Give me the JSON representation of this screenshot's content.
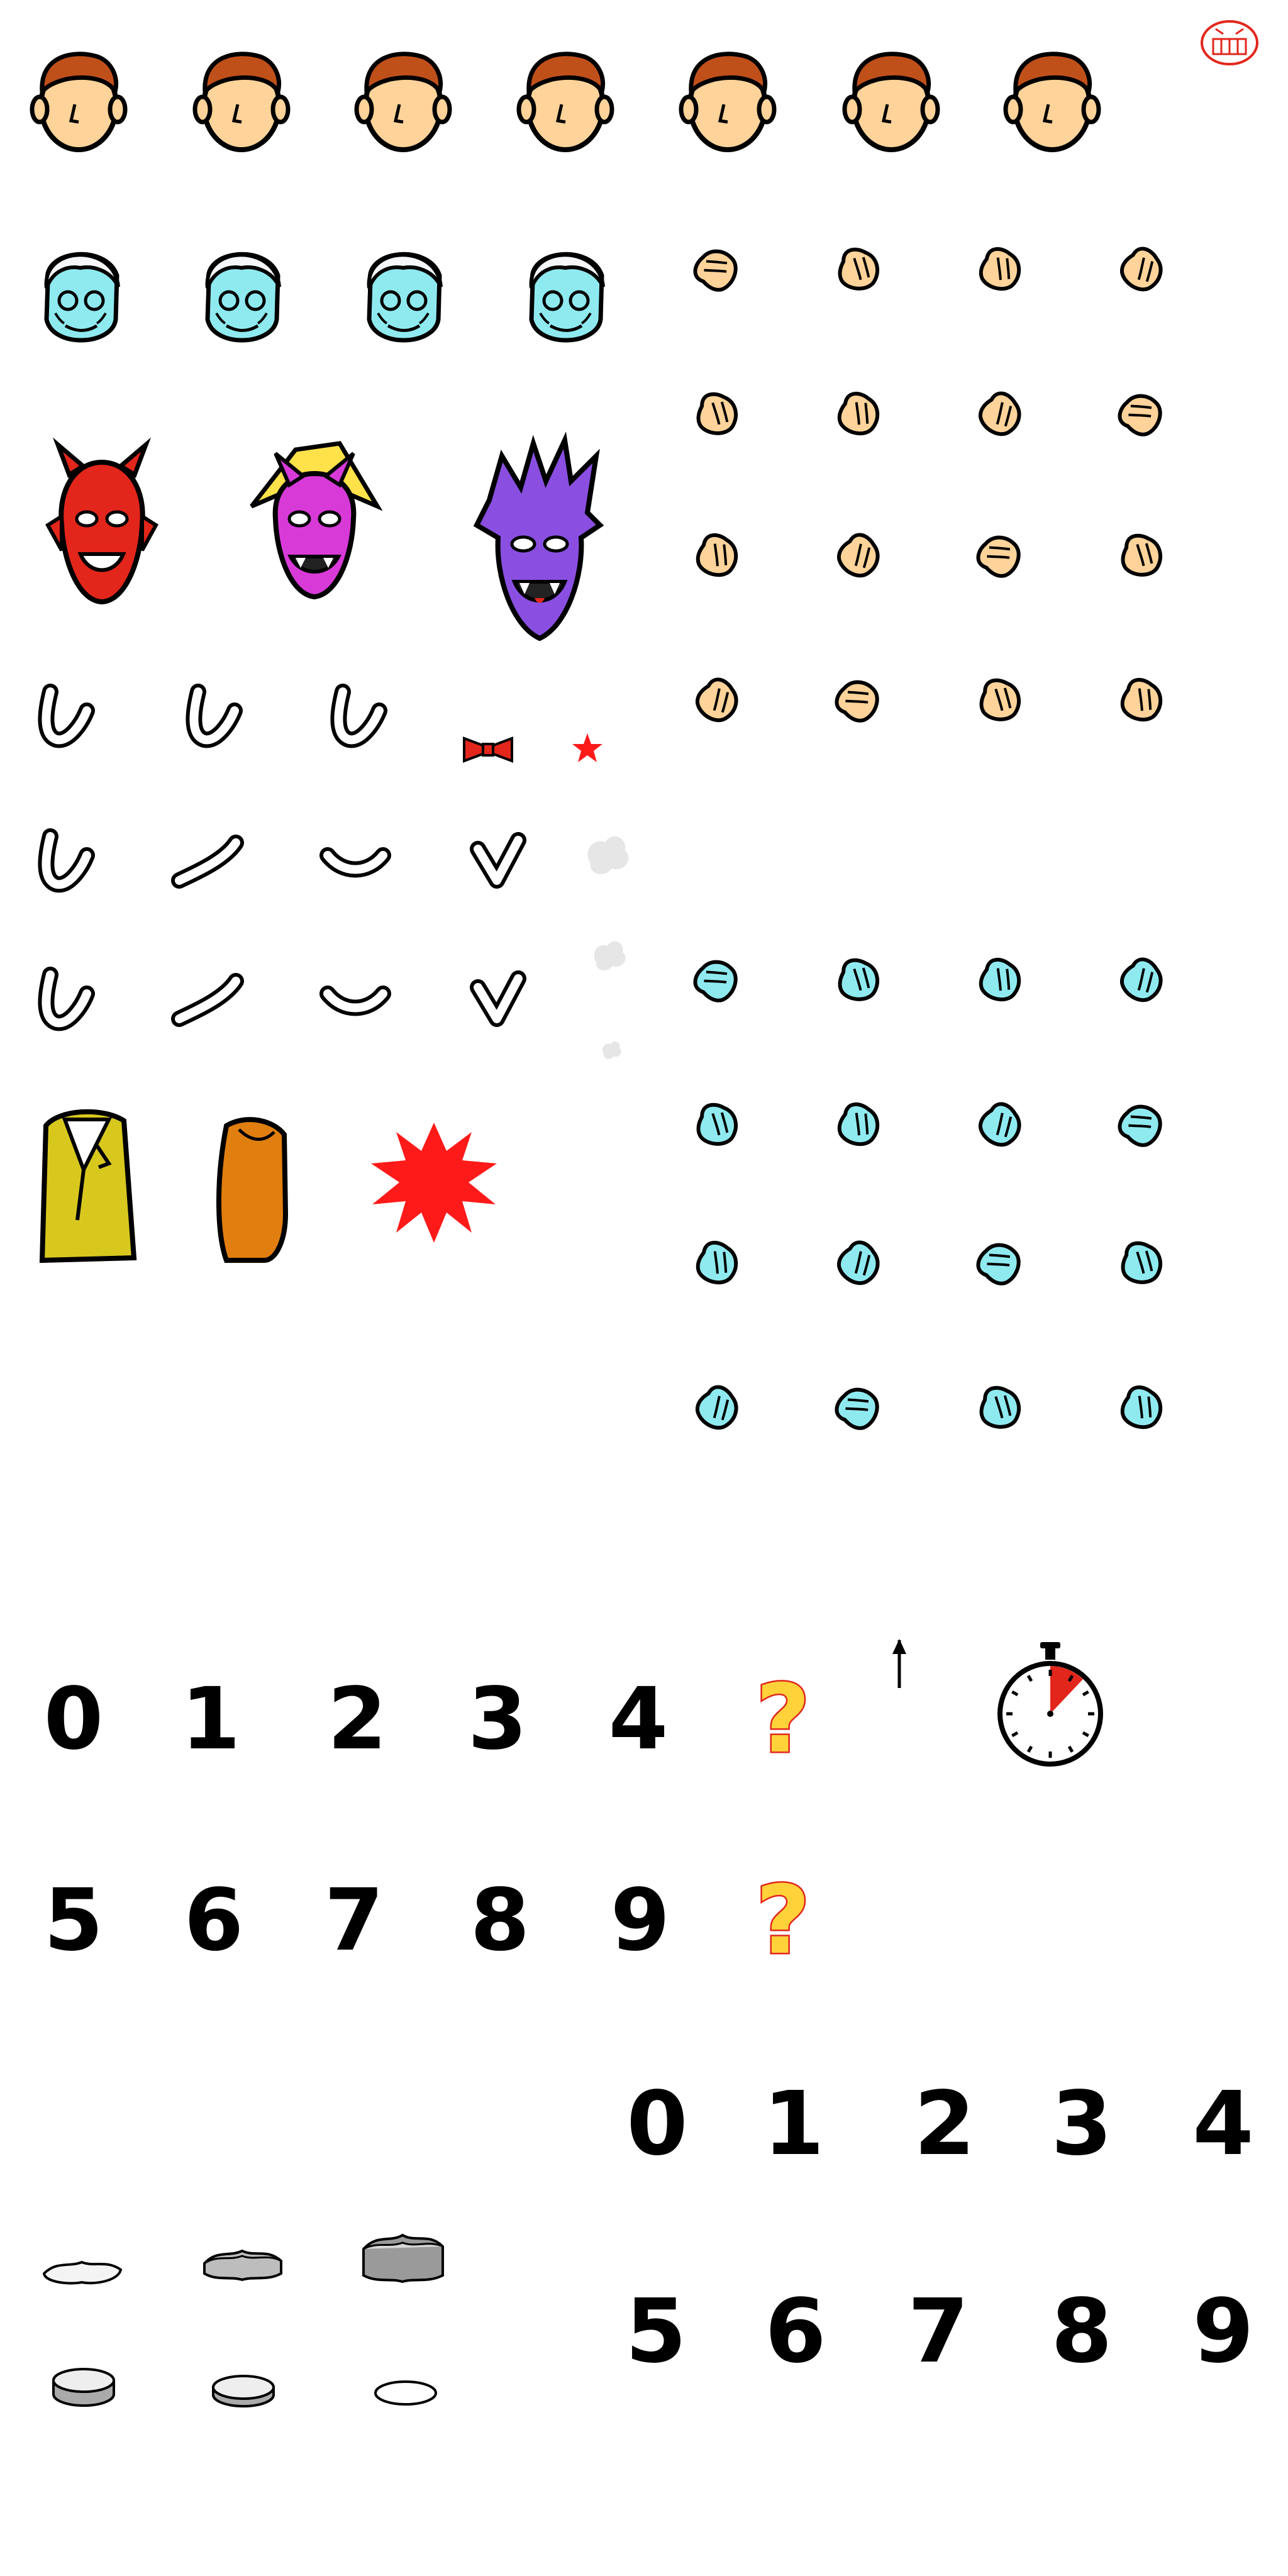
{
  "sheet": {
    "background": "#ffffff",
    "stamp_icon": "grinning-face-stamp-icon"
  },
  "colors": {
    "skin": "#ffd39a",
    "hair": "#c0501a",
    "ghost": "#8feaf0",
    "ghost_hair": "#f4f6f8",
    "red_demon": "#e2261b",
    "pink_demon": "#d83ad8",
    "purple_demon": "#8a4fe0",
    "yellow_jacket": "#d8c81e",
    "orange_body": "#e07e10",
    "burst": "#ff1a1a",
    "question_fill": "#ffd23a",
    "question_stroke": "#e2261b",
    "outline": "#000000"
  },
  "sprites": {
    "faces": [
      "face-neutral-icon",
      "face-sad-icon",
      "face-grin-icon",
      "face-happy-icon",
      "face-grimace-icon",
      "face-angry-icon",
      "face-blush-icon"
    ],
    "ghost_faces": [
      "ghost-face-icon",
      "ghost-face-icon",
      "ghost-face-icon",
      "ghost-face-icon"
    ],
    "demons": [
      "red-demon-icon",
      "pink-demon-icon",
      "purple-demon-icon"
    ],
    "arm_rows": 3,
    "arm_cols": 4,
    "skin_hand_rows": 4,
    "ghost_hand_rows": 4,
    "hand_cols": 4,
    "smoke_puffs": 3,
    "clothing": [
      "yellow-jacket-icon",
      "orange-body-icon"
    ],
    "burst": "red-explosion-icon",
    "bowtie": "red-bowtie-icon",
    "star": "red-star-icon",
    "arrow": "up-arrow-icon",
    "stopwatch": "stopwatch-icon",
    "rocks": 3,
    "discs": 3
  },
  "digits_large": {
    "row1": [
      "0",
      "1",
      "2",
      "3",
      "4",
      "?"
    ],
    "row2": [
      "5",
      "6",
      "7",
      "8",
      "9",
      "?"
    ]
  },
  "digits_small": {
    "row1": [
      "0",
      "1",
      "2",
      "3",
      "4"
    ],
    "row2": [
      "5",
      "6",
      "7",
      "8",
      "9"
    ]
  }
}
